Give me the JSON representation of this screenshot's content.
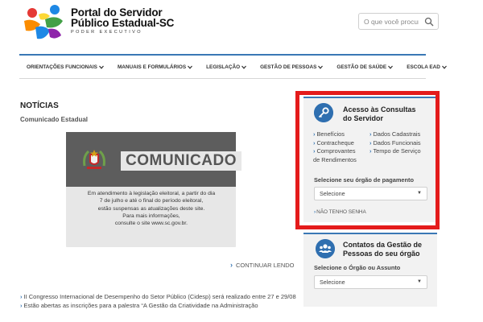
{
  "header": {
    "brand_line1": "Portal do Servidor",
    "brand_line2": "Público Estadual-SC",
    "brand_line3": "PODER EXECUTIVO",
    "search_placeholder": "O que você procura?"
  },
  "nav": {
    "items": [
      {
        "label": "ORIENTAÇÕES FUNCIONAIS"
      },
      {
        "label": "MANUAIS E FORMULÁRIOS"
      },
      {
        "label": "LEGISLAÇÃO"
      },
      {
        "label": "GESTÃO DE PESSOAS"
      },
      {
        "label": "GESTÃO DE SAÚDE"
      },
      {
        "label": "ESCOLA EAD"
      }
    ],
    "caret": "⌄"
  },
  "news": {
    "title": "NOTÍCIAS",
    "subtitle": "Comunicado Estadual",
    "banner_word": "COMUNICADO",
    "banner_lines": [
      "Em atendimento à legislação eleitoral, a partir do dia",
      "7 de julho e até o final do período eleitoral,",
      "estão suspensas as atualizações deste site.",
      "Para mais informações,",
      "consulte o site www.sc.gov.br."
    ],
    "continue_label": "CONTINUAR LENDO",
    "list": [
      "II Congresso Internacional de Desempenho do Setor Público (Cidesp) será realizado entre 27 e 29/08",
      "Estão abertas as inscrições para a palestra “A Gestão da Criatividade na Administração"
    ]
  },
  "consultas": {
    "title_line1": "Acesso às Consultas",
    "title_line2": "do Servidor",
    "links_left": [
      "Benefícios",
      "Contracheque",
      "Comprovantes",
      "de Rendimentos"
    ],
    "links_right": [
      "Dados Cadastrais",
      "Dados Funcionais",
      "Tempo de Serviço"
    ],
    "select_label": "Selecione seu órgão de pagamento",
    "select_value": "Selecione",
    "no_password": "NÃO TENHO SENHA"
  },
  "contatos": {
    "title_line1": "Contatos da Gestão de",
    "title_line2": "Pessoas do seu órgão",
    "select_label": "Selecione o Órgão ou Assunto",
    "select_value": "Selecione"
  },
  "colors": {
    "accent": "#3a78b5",
    "highlight": "#e41b1b",
    "badge": "#2f6fb0"
  }
}
